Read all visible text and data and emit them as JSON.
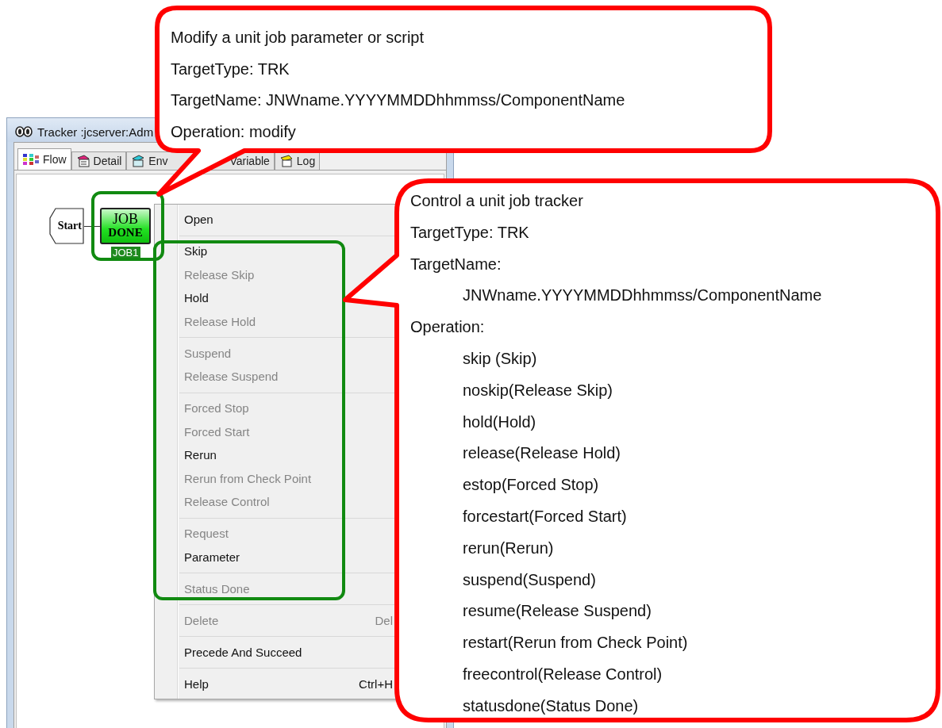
{
  "window": {
    "title": "Tracker :jcserver:Adm"
  },
  "tabs": [
    {
      "parts": [
        "Flow"
      ],
      "selected": true
    },
    {
      "parts": [
        "Detail"
      ],
      "selected": false
    },
    {
      "parts": [
        "Env",
        "Variable"
      ],
      "selected": false
    },
    {
      "parts": [
        "Log"
      ],
      "selected": false
    }
  ],
  "flow": {
    "nodes": [
      {
        "kind": "start",
        "label": "Start"
      },
      {
        "kind": "job",
        "status_lines": [
          "JOB",
          "DONE"
        ],
        "name": "JOB1",
        "selected": true
      }
    ]
  },
  "context_menu": {
    "items": [
      {
        "kind": "item",
        "label": "Open",
        "disabled": false
      },
      {
        "kind": "separator"
      },
      {
        "kind": "item",
        "label": "Skip",
        "disabled": false
      },
      {
        "kind": "item",
        "label": "Release Skip",
        "disabled": true
      },
      {
        "kind": "item",
        "label": "Hold",
        "disabled": false
      },
      {
        "kind": "item",
        "label": "Release Hold",
        "disabled": true
      },
      {
        "kind": "separator"
      },
      {
        "kind": "item",
        "label": "Suspend",
        "disabled": true
      },
      {
        "kind": "item",
        "label": "Release Suspend",
        "disabled": true
      },
      {
        "kind": "separator"
      },
      {
        "kind": "item",
        "label": "Forced Stop",
        "disabled": true
      },
      {
        "kind": "item",
        "label": "Forced Start",
        "disabled": true
      },
      {
        "kind": "item",
        "label": "Rerun",
        "disabled": false
      },
      {
        "kind": "item",
        "label": "Rerun from Check Point",
        "disabled": true
      },
      {
        "kind": "item",
        "label": "Release Control",
        "disabled": true
      },
      {
        "kind": "separator"
      },
      {
        "kind": "item",
        "label": "Request",
        "disabled": true
      },
      {
        "kind": "item",
        "label": "Parameter",
        "disabled": false
      },
      {
        "kind": "separator"
      },
      {
        "kind": "item",
        "label": "Status Done",
        "disabled": true
      },
      {
        "kind": "separator"
      },
      {
        "kind": "item",
        "label": "Delete",
        "disabled": true,
        "shortcut": "Del"
      },
      {
        "kind": "separator"
      },
      {
        "kind": "item",
        "label": "Precede And Succeed",
        "disabled": false
      },
      {
        "kind": "separator"
      },
      {
        "kind": "item",
        "label": "Help",
        "disabled": false,
        "shortcut": "Ctrl+H"
      }
    ]
  },
  "callouts": [
    {
      "lines": [
        {
          "text": "Modify a unit job parameter or script",
          "indented": false
        },
        {
          "text": "TargetType: TRK",
          "indented": false
        },
        {
          "text": "TargetName: JNWname.YYYYMMDDhhmmss/ComponentName",
          "indented": false
        },
        {
          "text": "Operation: modify",
          "indented": false
        }
      ]
    },
    {
      "lines": [
        {
          "text": "Control a unit job tracker",
          "indented": false
        },
        {
          "text": "TargetType: TRK",
          "indented": false
        },
        {
          "text": "TargetName:",
          "indented": false
        },
        {
          "text": "JNWname.YYYYMMDDhhmmss/ComponentName",
          "indented": true
        },
        {
          "text": "Operation:",
          "indented": false
        },
        {
          "text": "skip (Skip)",
          "indented": true
        },
        {
          "text": "noskip(Release Skip)",
          "indented": true
        },
        {
          "text": "hold(Hold)",
          "indented": true
        },
        {
          "text": "release(Release Hold)",
          "indented": true
        },
        {
          "text": "estop(Forced Stop)",
          "indented": true
        },
        {
          "text": "forcestart(Forced Start)",
          "indented": true
        },
        {
          "text": "rerun(Rerun)",
          "indented": true
        },
        {
          "text": "suspend(Suspend)",
          "indented": true
        },
        {
          "text": "resume(Release Suspend)",
          "indented": true
        },
        {
          "text": "restart(Rerun from Check Point)",
          "indented": true
        },
        {
          "text": "freecontrol(Release Control)",
          "indented": true
        },
        {
          "text": "statusdone(Status Done)",
          "indented": true
        }
      ]
    }
  ]
}
